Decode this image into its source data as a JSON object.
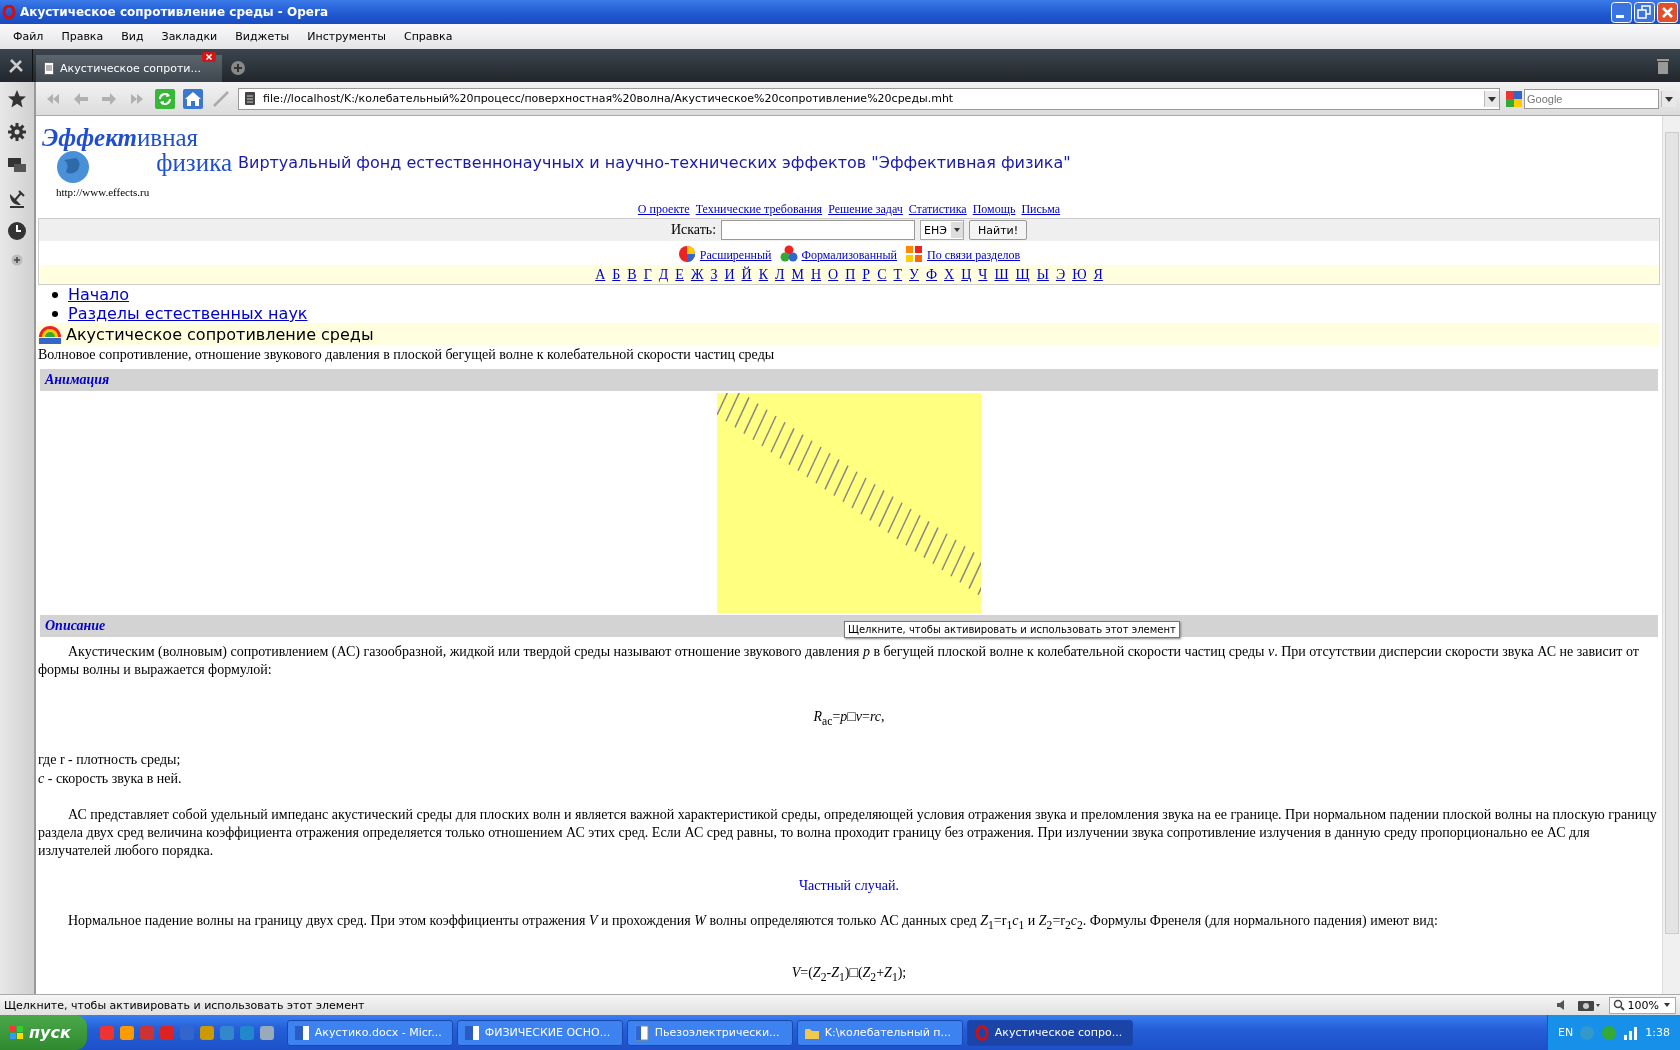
{
  "window": {
    "title": "Акустическое сопротивление среды - Opera"
  },
  "menu": [
    "Файл",
    "Правка",
    "Вид",
    "Закладки",
    "Виджеты",
    "Инструменты",
    "Справка"
  ],
  "tabs": [
    {
      "label": "Акустическое сопроти...",
      "selected": true
    }
  ],
  "address": {
    "url": "file://localhost/K:/колебательный%20процесс/поверхностная%20волна/Акустическое%20сопротивление%20среды.mht"
  },
  "search_engine": {
    "placeholder": "Google"
  },
  "page": {
    "logo": {
      "strong": "Эффект",
      "rest": "ивная",
      "second": "физика",
      "url": "http://www.effects.ru"
    },
    "site_title": "Виртуальный фонд естественнонаучных и научно-технических эффектов \"Эффективная физика\"",
    "nav_links": [
      "О проекте",
      "Технические требования",
      "Решение задач",
      "Статистика",
      "Помощь",
      "Письма"
    ],
    "search": {
      "label": "Искать:",
      "scope": "ЕНЭ",
      "button": "Найти!"
    },
    "search_modes": [
      {
        "label": "Расширенный",
        "kind": "extended"
      },
      {
        "label": "Формализованный",
        "kind": "formal"
      },
      {
        "label": "По связи разделов",
        "kind": "links"
      }
    ],
    "alphabet": [
      "А",
      "Б",
      "В",
      "Г",
      "Д",
      "Е",
      "Ж",
      "З",
      "И",
      "Й",
      "К",
      "Л",
      "М",
      "Н",
      "О",
      "П",
      "Р",
      "С",
      "Т",
      "У",
      "Ф",
      "Х",
      "Ц",
      "Ч",
      "Ш",
      "Щ",
      "Ы",
      "Э",
      "Ю",
      "Я"
    ],
    "breadcrumbs": [
      "Начало",
      "Разделы естественных наук"
    ],
    "heading": "Акустическое сопротивление среды",
    "summary": "Волновое сопротивление, отношение звукового давления в плоской бегущей волне к колебательной скорости частиц среды",
    "sections": [
      {
        "title": "Анимация",
        "kind": "animation"
      },
      {
        "title": "Описание",
        "kind": "text",
        "blocks": [
          {
            "kind": "para",
            "text": "Акустическим (волновым) сопротивлением (АС) газообразной, жидкой или твердой среды называют отношение звукового давления *p* в бегущей плоской волне к колебательной скорости частиц среды *v*. При отсутствии дисперсии скорости звука АС не зависит от формы волны и выражается формулой:"
          },
          {
            "kind": "formula",
            "text": "*R*$_{ac}$=*p*□*v*=*rc*,"
          },
          {
            "kind": "line",
            "text": "где r - плотность среды;"
          },
          {
            "kind": "line",
            "text": "*c* - скорость звука в ней."
          },
          {
            "kind": "para",
            "text": "АС представляет собой удельный импеданс акустический среды для плоских волн и является важной характеристикой среды, определяющей условия отражения звука и преломления звука на ее границе. При нормальном падении плоской волны на плоскую границу раздела двух сред величина коэффициента отражения определяется только отношением АС этих сред. Если АС сред равны, то волна проходит границу без отражения. При излучении звука сопротивление излучения в данную среду пропорционально ее АС для излучателей любого порядка."
          },
          {
            "kind": "subheading",
            "text": "Частный случай."
          },
          {
            "kind": "para",
            "text": "Нормальное падение волны на границу двух сред. При этом коэффициенты отражения *V* и прохождения *W* волны определяются только АС данных сред *Z*$_{1}$=r$_{1}$*c*$_{1}$ и *Z*$_{2}$=r$_{2}$*c*$_{2}$. Формулы Френеля (для нормального падения) имеют вид:"
          },
          {
            "kind": "formula",
            "text": "*V*=(*Z*$_{2}$-*Z*$_{1}$)□(*Z*$_{2}$+*Z*$_{1}$);"
          }
        ]
      }
    ]
  },
  "tooltip": "Щелкните, чтобы активировать и использовать этот элемент",
  "status_bar": {
    "text": "Щелкните, чтобы активировать и использовать этот элемент",
    "zoom": "100%"
  },
  "taskbar": {
    "start": "пуск",
    "tasks": [
      {
        "label": "Акустико.docx - Micr...",
        "kind": "word",
        "selected": false
      },
      {
        "label": "ФИЗИЧЕСКИЕ ОСНО...",
        "kind": "word",
        "selected": false
      },
      {
        "label": "Пьезоэлектрически...",
        "kind": "doc",
        "selected": false
      },
      {
        "label": "K:\\колебательный п...",
        "kind": "folder",
        "selected": false
      },
      {
        "label": "Акустическое сопро...",
        "kind": "opera",
        "selected": true
      }
    ],
    "language": "EN",
    "clock": "1:38"
  }
}
